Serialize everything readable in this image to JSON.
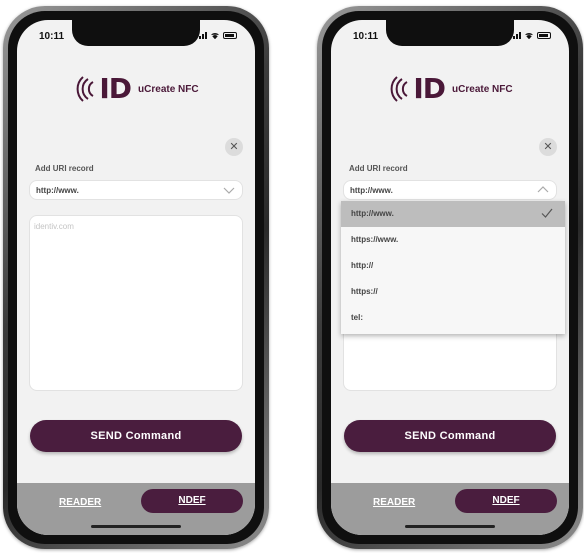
{
  "app": {
    "logo_mark": "ID",
    "logo_text": "uCreate NFC"
  },
  "status_bar": {
    "time": "10:11"
  },
  "form": {
    "label": "Add URI record",
    "selected_prefix": "http://www.",
    "content_placeholder": "identiv.com",
    "close_icon": "close-icon"
  },
  "prefix_dropdown": {
    "options": [
      "http://www.",
      "https://www.",
      "http://",
      "https://",
      "tel:"
    ],
    "selected_index": 0
  },
  "actions": {
    "send_label": "SEND Command"
  },
  "tabs": {
    "reader_label": "READER",
    "ndef_label": "NDEF",
    "active": "NDEF"
  },
  "colors": {
    "brand": "#4a1d3e",
    "tabbar": "#9c9c9c",
    "screen_bg": "#f2f2f2"
  }
}
